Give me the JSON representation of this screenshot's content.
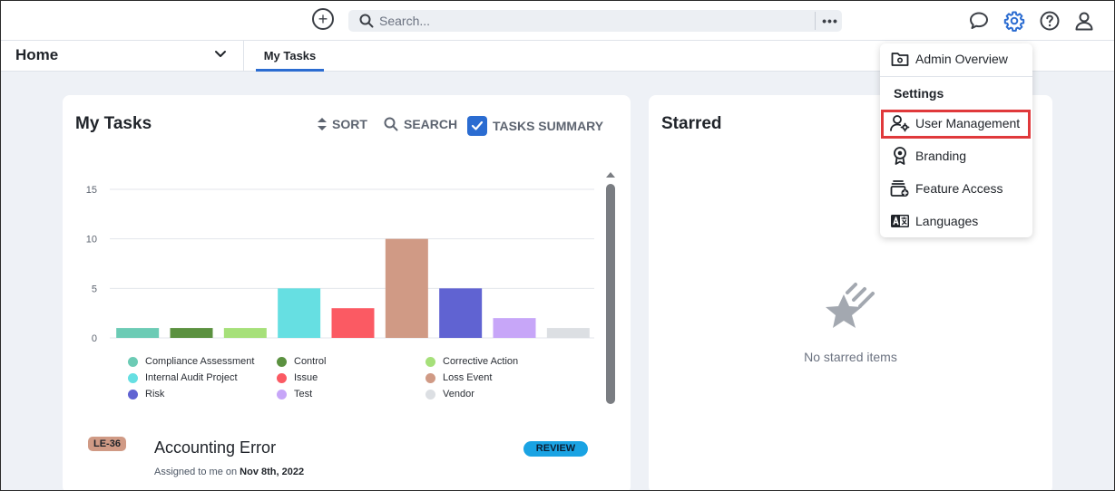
{
  "topbar": {
    "search_placeholder": "Search...",
    "more_label": "•••"
  },
  "nav": {
    "home_label": "Home",
    "tab_label": "My Tasks"
  },
  "tasks_card": {
    "title": "My Tasks",
    "sort_label": "SORT",
    "search_label": "SEARCH",
    "summary_label": "TASKS SUMMARY",
    "task": {
      "id": "LE-36",
      "title": "Accounting Error",
      "status": "REVIEW",
      "assigned_prefix": "Assigned to me on ",
      "assigned_date": "Nov 8th, 2022"
    }
  },
  "starred_card": {
    "title": "Starred",
    "empty_text": "No starred items"
  },
  "menu": {
    "admin_overview": "Admin Overview",
    "settings_heading": "Settings",
    "user_management": "User Management",
    "branding": "Branding",
    "feature_access": "Feature Access",
    "languages": "Languages"
  },
  "chart_data": {
    "type": "bar",
    "categories": [
      "Compliance Assessment",
      "Control",
      "Corrective Action",
      "Internal Audit Project",
      "Issue",
      "Loss Event",
      "Risk",
      "Test",
      "Vendor"
    ],
    "values": [
      1,
      1,
      1,
      5,
      3,
      10,
      5,
      2,
      1
    ],
    "colors": [
      "#6ccbb5",
      "#5b9140",
      "#a6e07a",
      "#66dfe2",
      "#fb5a63",
      "#d09a85",
      "#6063d2",
      "#c7a6f8",
      "#dcdfe3"
    ],
    "yticks": [
      0,
      5,
      10,
      15
    ],
    "ylim": [
      0,
      15
    ],
    "grid": true,
    "legend_position": "bottom"
  }
}
